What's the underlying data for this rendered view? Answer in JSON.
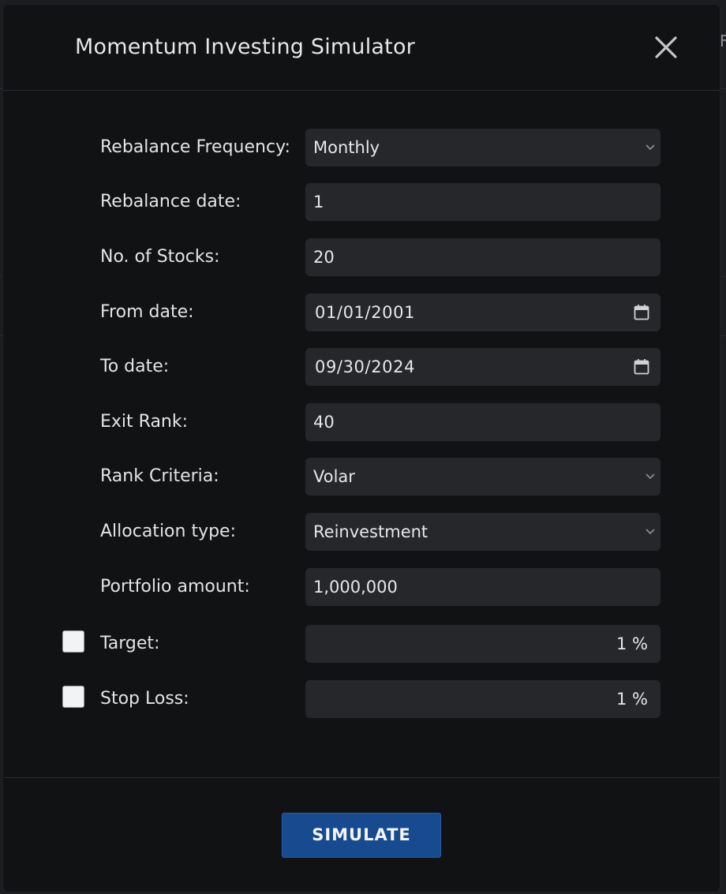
{
  "modal": {
    "title": "Momentum Investing Simulator",
    "close_icon": "close-icon"
  },
  "form": {
    "rebalance_frequency": {
      "label": "Rebalance Frequency:",
      "value": "Monthly"
    },
    "rebalance_date": {
      "label": "Rebalance date:",
      "value": "1"
    },
    "no_of_stocks": {
      "label": "No. of Stocks:",
      "value": "20"
    },
    "from_date": {
      "label": "From date:",
      "value": "01/01/2001"
    },
    "to_date": {
      "label": "To date:",
      "value": "09/30/2024"
    },
    "exit_rank": {
      "label": "Exit Rank:",
      "value": "40"
    },
    "rank_criteria": {
      "label": "Rank Criteria:",
      "value": "Volar"
    },
    "allocation_type": {
      "label": "Allocation type:",
      "value": "Reinvestment"
    },
    "portfolio_amount": {
      "label": "Portfolio amount:",
      "value": "1,000,000"
    },
    "target": {
      "label": "Target:",
      "value": "1 %",
      "checked": false
    },
    "stop_loss": {
      "label": "Stop Loss:",
      "value": "1 %",
      "checked": false
    }
  },
  "actions": {
    "simulate_label": "SIMULATE"
  },
  "icons": {
    "dropdown": "chevron-down-icon",
    "date_picker": "calendar-icon",
    "close": "close-icon"
  },
  "colors": {
    "modal_background": "#111214",
    "field_background": "#26272b",
    "primary_button": "#174a8f",
    "text": "#e6e7e9"
  },
  "backdrop": {
    "edge_glyph": "F"
  }
}
